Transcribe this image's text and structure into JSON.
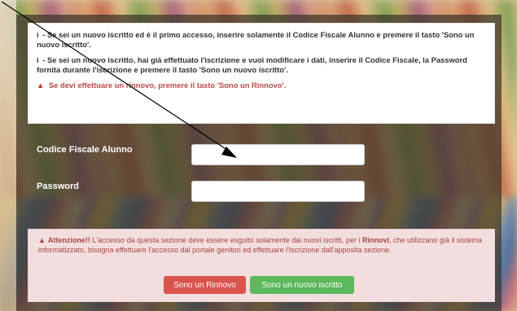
{
  "info": {
    "line1_prefix": "i",
    "line1": "- Se sei un nuovo iscritto ed è il primo accesso, inserire solamente il Codice Fiscale Alunno e premere il tasto 'Sono un nuovo iscritto'.",
    "line2_prefix": "i",
    "line2": "- Se sei un nuovo iscritto, hai già effettuato l'iscrizione e vuoi modificare i dati, inserire il Codice Fiscale, la Password fornita durante l'iscrizione e premere il tasto 'Sono un nuovo iscritto'.",
    "renewal_warning": "Se devi effettuare un rinnovo, premere il tasto 'Sono un Rinnovo'."
  },
  "form": {
    "codice_label": "Codice Fiscale Alunno",
    "codice_value": "",
    "password_label": "Password",
    "password_value": ""
  },
  "alert": {
    "title": "Attenzione!!",
    "text_before": " L'accesso da questa sezione deve essere esguito solamente dai nuovi iscritti, per i ",
    "bold_word": "Rinnovi",
    "text_after": ", che utilizzano già il sistema informatizzato, bisogna effettuare l'accesso dal portale genitori ed effettuare l'iscrizione dall'apposita sezione."
  },
  "buttons": {
    "rinnovo": "Sono un Rinnovo",
    "nuovo": "Sono un nuovo iscritto"
  },
  "colors": {
    "danger": "#d9534f",
    "success": "#5cb85c",
    "alert_bg": "#f2dede"
  }
}
